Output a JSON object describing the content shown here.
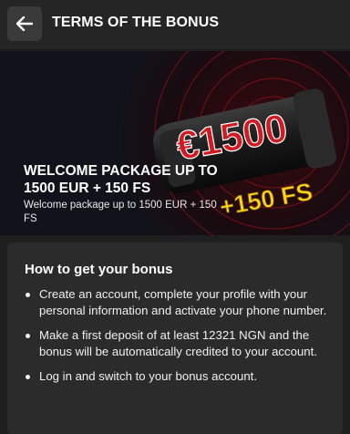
{
  "header": {
    "back_icon": "arrow-left-icon",
    "title": "TERMS OF THE BONUS"
  },
  "banner": {
    "title": "WELCOME PACKAGE UP TO 1500 EUR + 150 FS",
    "subtitle": "Welcome package up to 1500 EUR + 150 FS",
    "graphic_amount": "€1500",
    "graphic_spins": "+150 FS",
    "accent_red": "#d11a22",
    "accent_yellow": "#ffd21a"
  },
  "bonus_info": {
    "title": "How to get your bonus",
    "steps": [
      "Create an account, complete your profile with your personal information and activate your phone number.",
      "Make a first deposit of at least 12321 NGN and the bonus will be automatically credited to your account.",
      "Log in and switch to your bonus account."
    ]
  }
}
